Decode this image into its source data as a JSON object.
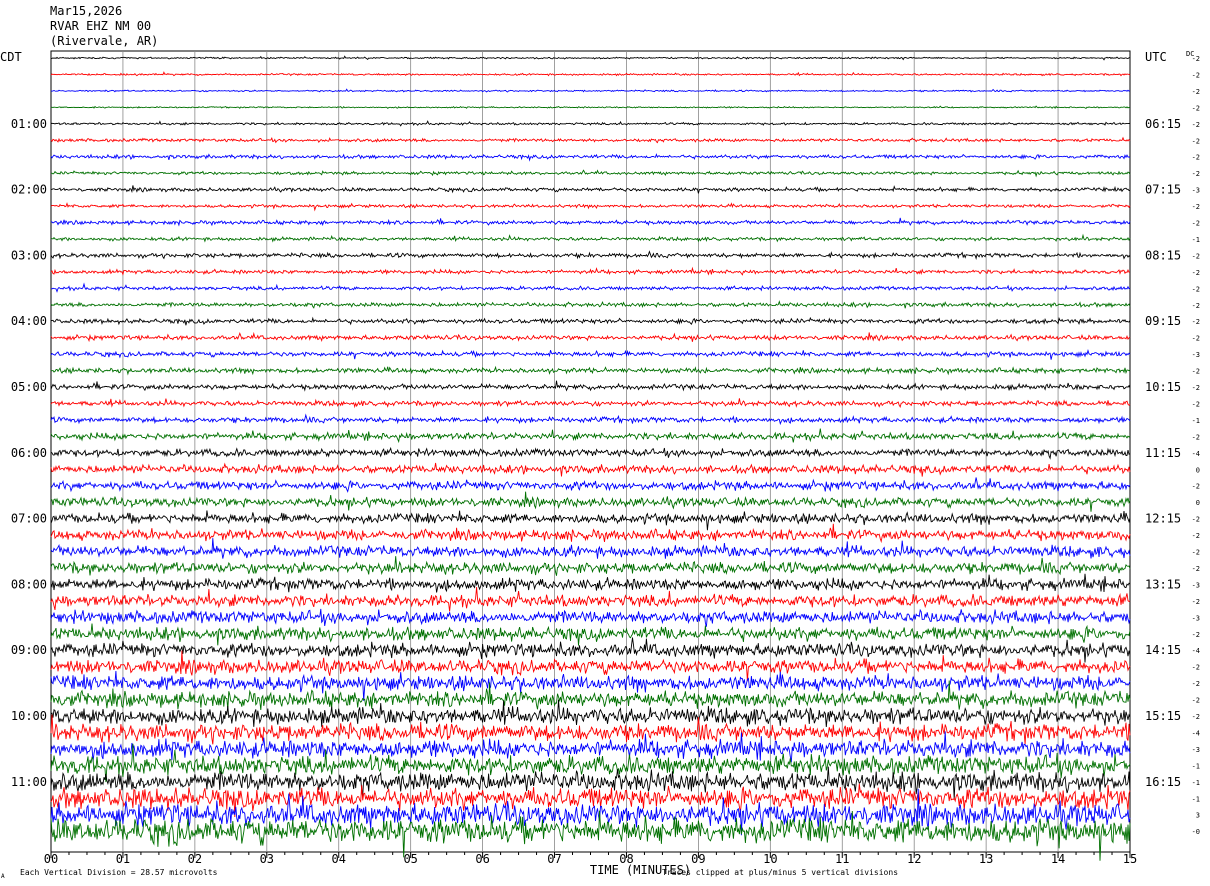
{
  "header": {
    "date": "Mar15,2026",
    "station": "RVAR EHZ NM 00",
    "location": "(Rivervale, AR)"
  },
  "chart_data": {
    "type": "line",
    "title": "RVAR EHZ NM 00",
    "xlabel": "TIME (MINUTES)",
    "left_axis_label": "CDT",
    "right_axis_label": "UTC",
    "dc_label": "DC",
    "x_range": [
      0,
      15
    ],
    "x_ticks": [
      "00",
      "01",
      "02",
      "03",
      "04",
      "05",
      "06",
      "07",
      "08",
      "09",
      "10",
      "11",
      "12",
      "13",
      "14",
      "15"
    ],
    "row_count": 48,
    "rows_per_hour": 4,
    "trace_colors": [
      "#000000",
      "#ff0000",
      "#0000ff",
      "#007000"
    ],
    "left_hour_labels": [
      "01:00",
      "02:00",
      "03:00",
      "04:00",
      "05:00",
      "06:00",
      "07:00",
      "08:00",
      "09:00",
      "10:00",
      "11:00"
    ],
    "right_hour_labels": [
      "06:15",
      "07:15",
      "08:15",
      "09:15",
      "10:15",
      "11:15",
      "12:15",
      "13:15",
      "14:15",
      "15:15",
      "16:15"
    ],
    "hour_label_first_row": 4,
    "dc_offsets": [
      "-2",
      "-2",
      "-2",
      "-2",
      "-2",
      "-2",
      "-2",
      "-2",
      "-3",
      "-2",
      "-2",
      "-1",
      "-2",
      "-2",
      "-2",
      "-2",
      "-2",
      "-2",
      "-3",
      "-2",
      "-2",
      "-2",
      "-1",
      "-2",
      "-4",
      "0",
      "-2",
      "0",
      "-2",
      "-2",
      "-2",
      "-2",
      "-3",
      "-2",
      "-3",
      "-2",
      "-4",
      "-2",
      "-2",
      "-2",
      "-2",
      "-4",
      "-3",
      "-1",
      "-1",
      "-1",
      "3",
      "-0"
    ],
    "amplitude_by_row": [
      0.7,
      0.8,
      0.7,
      0.6,
      1.0,
      1.4,
      1.6,
      1.3,
      1.6,
      1.4,
      1.7,
      1.5,
      1.9,
      1.7,
      1.6,
      1.8,
      2.0,
      2.0,
      2.1,
      2.2,
      2.3,
      2.2,
      2.4,
      3.0,
      3.2,
      3.6,
      3.8,
      4.0,
      4.3,
      4.6,
      4.9,
      5.0,
      5.1,
      5.3,
      5.6,
      5.8,
      5.9,
      6.1,
      6.6,
      7.0,
      7.4,
      7.6,
      7.9,
      8.3,
      8.7,
      9.2,
      9.8,
      11.0
    ],
    "footer_left": "Each Vertical Division =   28.57 microvolts",
    "footer_right": "Traces clipped at plus/minus 5 vertical divisions",
    "corner_mark": "A"
  }
}
